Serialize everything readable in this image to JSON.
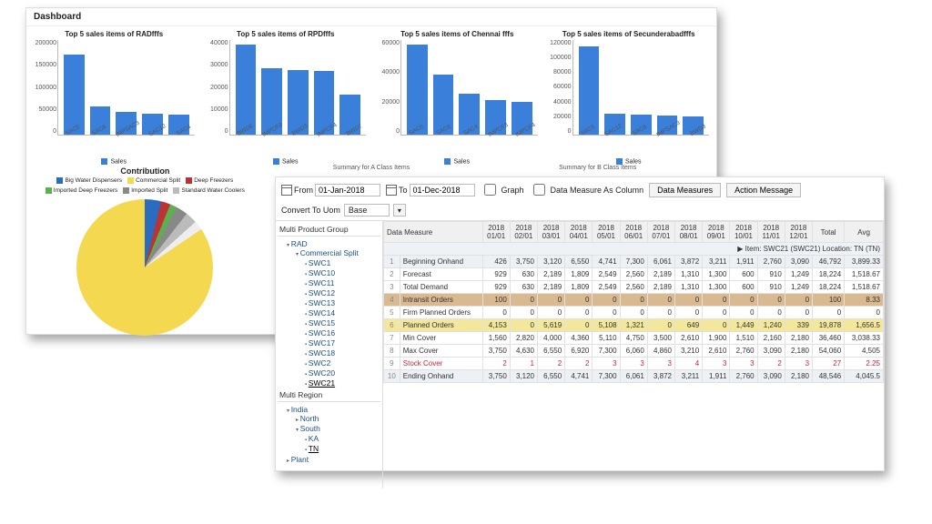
{
  "dashboard": {
    "title": "Dashboard",
    "contribution_title": "Contribution",
    "sales_legend": "Sales",
    "sub_caption_a": "Summary for A Class Items",
    "sub_caption_b": "Summary for B Class Items",
    "pie_legend": [
      {
        "label": "Big Water Dispensers",
        "color": "#2a6cc0"
      },
      {
        "label": "Commercial Split",
        "color": "#f4d84f"
      },
      {
        "label": "Deep Freezers",
        "color": "#b33"
      },
      {
        "label": "Imported Deep Freezers",
        "color": "#5bb04f"
      },
      {
        "label": "Imported Split",
        "color": "#888"
      },
      {
        "label": "Standard Water Coolers",
        "color": "#bbb"
      }
    ]
  },
  "chart_data": [
    {
      "type": "bar",
      "title": "Top 5 sales items of RADfffs",
      "categories": [
        "SAC5",
        "SAC6",
        "IMPSAC3",
        "SAC12",
        "SAC4"
      ],
      "values": [
        170000,
        60000,
        48000,
        45000,
        43000
      ],
      "ylim": [
        0,
        200000
      ],
      "yticks": [
        0,
        50000,
        100000,
        150000,
        200000
      ],
      "legend": "Sales"
    },
    {
      "type": "bar",
      "title": "Top 5 sales items of RPDfffs",
      "categories": [
        "BWD6",
        "IMPCF3",
        "BWD3",
        "IMPCF4",
        "BWD7"
      ],
      "values": [
        38000,
        28000,
        27500,
        27000,
        17000
      ],
      "ylim": [
        0,
        40000
      ],
      "yticks": [
        0,
        10000,
        20000,
        30000,
        40000
      ],
      "legend": "Sales"
    },
    {
      "type": "bar",
      "title": "Top 5 sales items of Chennai fffs",
      "categories": [
        "SAC5",
        "SAC6",
        "SAC4",
        "IMPCF3",
        "IMPCF4"
      ],
      "values": [
        57000,
        38000,
        26000,
        22000,
        21000
      ],
      "ylim": [
        0,
        60000
      ],
      "yticks": [
        0,
        20000,
        40000,
        60000
      ],
      "legend": "Sales"
    },
    {
      "type": "bar",
      "title": "Top 5 sales items of Secunderabadfffs",
      "categories": [
        "SAC5",
        "SAC12",
        "SAC6",
        "IMPSAC3",
        "BWD3"
      ],
      "values": [
        112000,
        27000,
        25000,
        24000,
        23000
      ],
      "ylim": [
        0,
        120000
      ],
      "yticks": [
        0,
        20000,
        40000,
        60000,
        80000,
        100000,
        120000
      ],
      "legend": "Sales"
    }
  ],
  "toolbar": {
    "from_label": "From",
    "from_value": "01-Jan-2018",
    "to_label": "To",
    "to_value": "01-Dec-2018",
    "graph_label": "Graph",
    "dmcol_label": "Data Measure As Column",
    "data_measures_btn": "Data Measures",
    "action_msg_btn": "Action Message",
    "convert_label": "Convert To Uom",
    "convert_value": "Base"
  },
  "tree": {
    "product_title": "Multi Product Group",
    "region_title": "Multi Region",
    "rad": "RAD",
    "commercial_split": "Commercial Split",
    "swc_items": [
      "SWC1",
      "SWC10",
      "SWC11",
      "SWC12",
      "SWC13",
      "SWC14",
      "SWC15",
      "SWC16",
      "SWC17",
      "SWC18",
      "SWC2",
      "SWC20",
      "SWC21"
    ],
    "india": "India",
    "north": "North",
    "south": "South",
    "ka": "KA",
    "tn": "TN",
    "plant": "Plant"
  },
  "grid": {
    "dm_header": "Data Measure",
    "periods": [
      "2018 01/01",
      "2018 02/01",
      "2018 03/01",
      "2018 04/01",
      "2018 05/01",
      "2018 06/01",
      "2018 07/01",
      "2018 08/01",
      "2018 09/01",
      "2018 10/01",
      "2018 11/01",
      "2018 12/01"
    ],
    "total_header": "Total",
    "avg_header": "Avg",
    "context": "Item: SWC21 (SWC21) Location: TN (TN)",
    "rows": [
      {
        "n": 1,
        "label": "Beginning Onhand",
        "class": "grey",
        "v": [
          426,
          3750,
          3120,
          6550,
          4741,
          7300,
          6061,
          3872,
          3211,
          1911,
          2760,
          3090
        ],
        "total": 46792,
        "avg": "3,899.33"
      },
      {
        "n": 2,
        "label": "Forecast",
        "class": "",
        "v": [
          929,
          630,
          2189,
          1809,
          2549,
          2560,
          2189,
          1310,
          1300,
          600,
          910,
          1249
        ],
        "total": 18224,
        "avg": "1,518.67"
      },
      {
        "n": 3,
        "label": "Total Demand",
        "class": "",
        "v": [
          929,
          630,
          2189,
          1809,
          2549,
          2560,
          2189,
          1310,
          1300,
          600,
          910,
          1249
        ],
        "total": 18224,
        "avg": "1,518.67"
      },
      {
        "n": 4,
        "label": "Intransit Orders",
        "class": "tan",
        "v": [
          100,
          0,
          0,
          0,
          0,
          0,
          0,
          0,
          0,
          0,
          0,
          0
        ],
        "total": 100,
        "avg": "8.33"
      },
      {
        "n": 5,
        "label": "Firm Planned Orders",
        "class": "",
        "v": [
          0,
          0,
          0,
          0,
          0,
          0,
          0,
          0,
          0,
          0,
          0,
          0
        ],
        "total": 0,
        "avg": "0"
      },
      {
        "n": 6,
        "label": "Planned Orders",
        "class": "yellow",
        "v": [
          4153,
          0,
          5619,
          0,
          5108,
          1321,
          0,
          649,
          0,
          1449,
          1240,
          339
        ],
        "total": 19878,
        "avg": "1,656.5"
      },
      {
        "n": 7,
        "label": "Min Cover",
        "class": "",
        "v": [
          1560,
          2820,
          4000,
          4360,
          5110,
          4750,
          3500,
          2610,
          1900,
          1510,
          2160,
          2180
        ],
        "total": 36460,
        "avg": "3,038.33"
      },
      {
        "n": 8,
        "label": "Max Cover",
        "class": "",
        "v": [
          3750,
          4630,
          6550,
          6920,
          7300,
          6060,
          4860,
          3210,
          2610,
          2760,
          3090,
          2180
        ],
        "total": 54060,
        "avg": "4,505"
      },
      {
        "n": 9,
        "label": "Stock Cover",
        "class": "red",
        "v": [
          2,
          1,
          2,
          2,
          3,
          3,
          3,
          4,
          3,
          3,
          2,
          3
        ],
        "total": 27,
        "avg": "2.25"
      },
      {
        "n": 10,
        "label": "Ending Onhand",
        "class": "grey",
        "v": [
          3750,
          3120,
          6550,
          4741,
          7300,
          6061,
          3872,
          3211,
          1911,
          2760,
          3090,
          2180
        ],
        "total": 48546,
        "avg": "4,045.5"
      }
    ]
  }
}
